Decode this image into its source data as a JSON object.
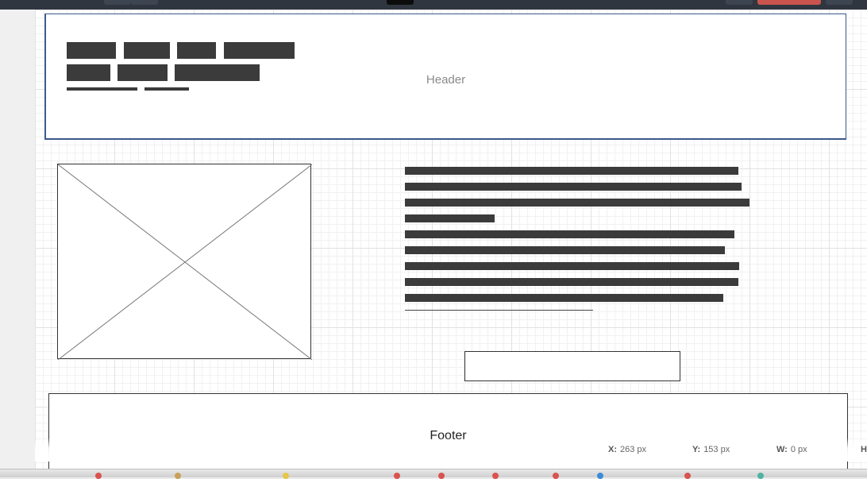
{
  "canvas": {
    "header_label": "Header",
    "footer_label": "Footer"
  },
  "status": {
    "x_key": "X:",
    "x_val": "263 px",
    "y_key": "Y:",
    "y_val": "153 px",
    "w_key": "W:",
    "w_val": "0 px",
    "h_key": "H"
  },
  "colors": {
    "toolbar_bg": "#2f3640",
    "accent_red": "#c9544d",
    "wire_block": "#3b3b3b",
    "header_border": "#3a5a8c"
  }
}
